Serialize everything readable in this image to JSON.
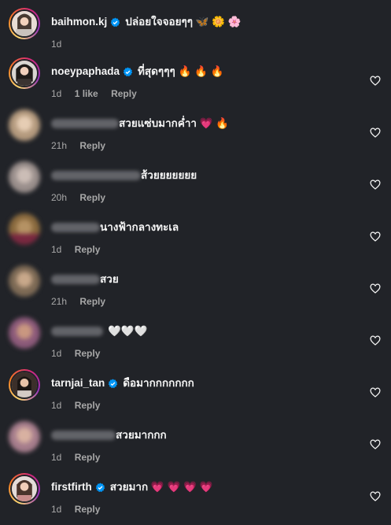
{
  "accent_colors": {
    "verified": "#0095f6",
    "ring_from": "#feda75",
    "ring_to": "#962fbf"
  },
  "comments": [
    {
      "username": "baihmon.kj",
      "verified": true,
      "text": "ปล่อยใจจอยๆๆ 🦋 🌼 🌸",
      "time": "1d",
      "likes": "",
      "reply": "",
      "show_like": false
    },
    {
      "username": "noeypaphada",
      "verified": true,
      "text": "ที่สุดๆๆๆ 🔥 🔥 🔥",
      "time": "1d",
      "likes": "1 like",
      "reply": "Reply",
      "show_like": true
    },
    {
      "username": "",
      "verified": false,
      "text": "สวยแซ่บมากค่ำา 💗 🔥",
      "time": "21h",
      "likes": "",
      "reply": "Reply",
      "show_like": true
    },
    {
      "username": "",
      "verified": false,
      "text": "ส้วยยยยยยย",
      "time": "20h",
      "likes": "",
      "reply": "Reply",
      "show_like": true
    },
    {
      "username": "",
      "verified": false,
      "text": "นางฟ้ากลางทะเล",
      "time": "1d",
      "likes": "",
      "reply": "Reply",
      "show_like": true
    },
    {
      "username": "",
      "verified": false,
      "text": "สวย",
      "time": "21h",
      "likes": "",
      "reply": "Reply",
      "show_like": true
    },
    {
      "username": "",
      "verified": false,
      "text": "🤍🤍🤍",
      "time": "1d",
      "likes": "",
      "reply": "Reply",
      "show_like": true
    },
    {
      "username": "tarnjai_tan",
      "verified": true,
      "text": "ดือมากกกกกกก",
      "time": "1d",
      "likes": "",
      "reply": "Reply",
      "show_like": true
    },
    {
      "username": "",
      "verified": false,
      "text": "สวยมากกก",
      "time": "1d",
      "likes": "",
      "reply": "Reply",
      "show_like": true
    },
    {
      "username": "firstfirth",
      "verified": true,
      "text": "สวยมาก 💗 💗 💗 💗",
      "time": "1d",
      "likes": "",
      "reply": "Reply",
      "show_like": true
    }
  ],
  "icons": {
    "like": "heart-outline-icon",
    "verified": "verified-badge-icon"
  }
}
